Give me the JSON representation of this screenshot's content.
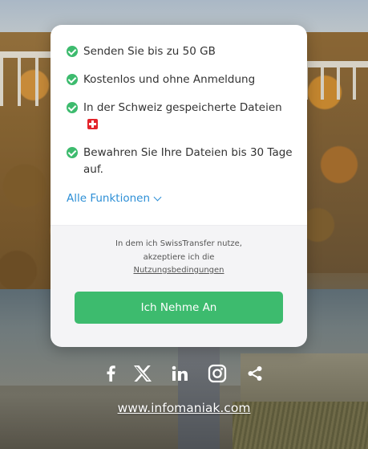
{
  "features": [
    {
      "text": "Senden Sie bis zu 50 GB"
    },
    {
      "text": "Kostenlos und ohne Anmeldung"
    },
    {
      "text": "In der Schweiz gespeicherte Dateien"
    },
    {
      "text": "Bewahren Sie Ihre Dateien bis 30 Tage auf."
    }
  ],
  "all_functions_label": "Alle Funktionen",
  "consent": {
    "line1": "In dem ich SwissTransfer nutze,",
    "line2": "akzeptiere ich die",
    "terms_link": "Nutzungsbedingungen"
  },
  "accept_button_label": "Ich Nehme An",
  "social_icons": [
    "facebook-icon",
    "x-icon",
    "linkedin-icon",
    "instagram-icon",
    "share-icon"
  ],
  "footer_link": "www.infomaniak.com",
  "colors": {
    "accent_green": "#3dbb6e",
    "link_blue": "#2d8fd6",
    "swiss_red": "#e3242b"
  }
}
